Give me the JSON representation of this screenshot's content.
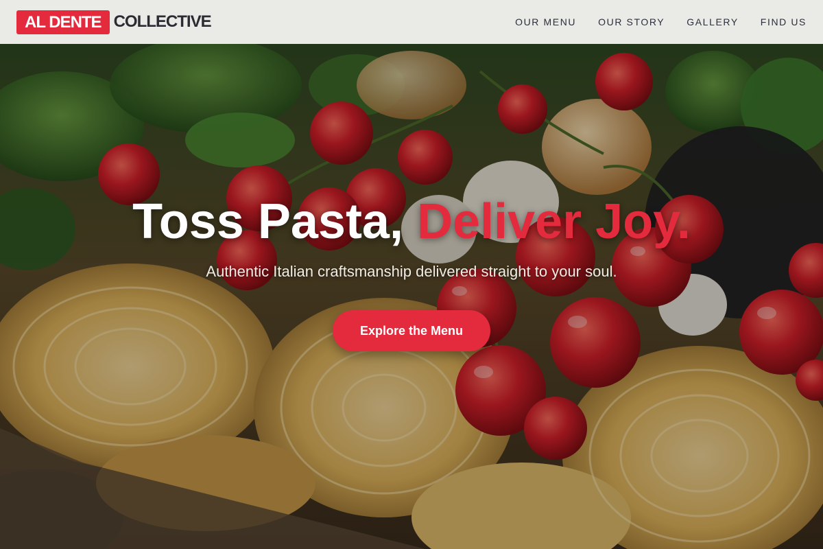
{
  "brand": {
    "badge_text": "AL DENTE",
    "name_text": "COLLECTIVE"
  },
  "nav": {
    "items": [
      {
        "label": "OUR MENU"
      },
      {
        "label": "OUR STORY"
      },
      {
        "label": "GALLERY"
      },
      {
        "label": "FIND US"
      }
    ]
  },
  "hero": {
    "headline_main": "Toss Pasta, ",
    "headline_accent": "Deliver Joy.",
    "subtitle": "Authentic Italian craftsmanship delivered straight to your soul.",
    "cta_label": "Explore the Menu",
    "background": "hero-pasta-tomatoes-image"
  },
  "colors": {
    "accent": "#e32b3d",
    "header_bg": "#eaeae6",
    "nav_text": "#2a2f3a"
  }
}
